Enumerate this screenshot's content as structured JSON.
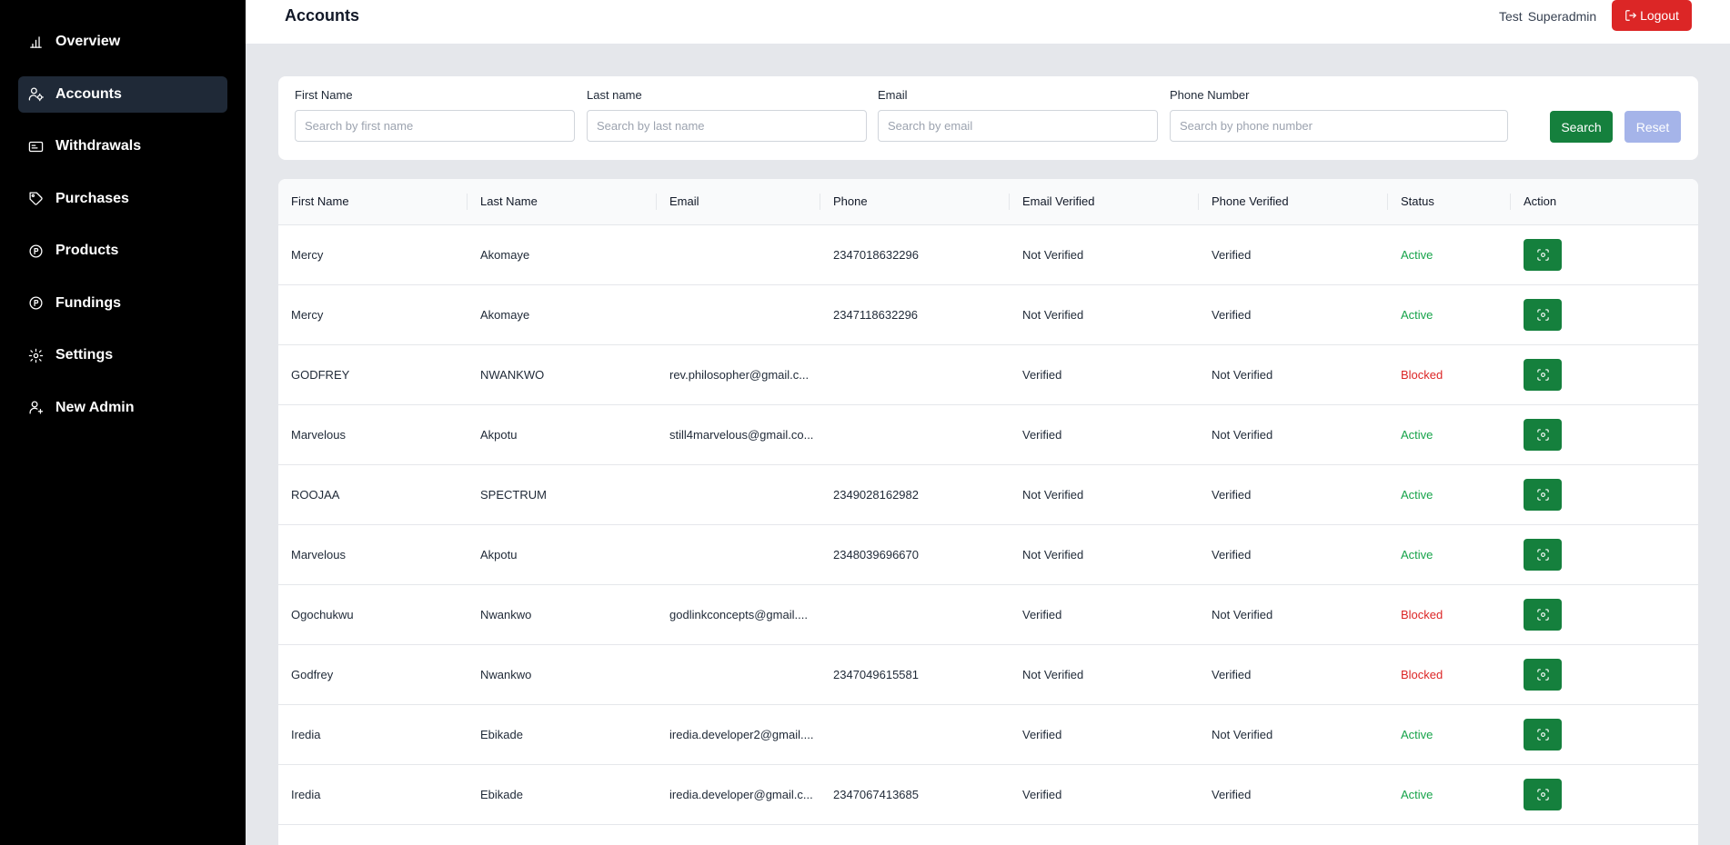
{
  "sidebar": {
    "items": [
      {
        "label": "Overview",
        "icon": "bar-chart-icon"
      },
      {
        "label": "Accounts",
        "icon": "users-gear-icon",
        "active": true
      },
      {
        "label": "Withdrawals",
        "icon": "card-icon"
      },
      {
        "label": "Purchases",
        "icon": "tag-icon"
      },
      {
        "label": "Products",
        "icon": "product-coin-icon"
      },
      {
        "label": "Fundings",
        "icon": "funding-coin-icon"
      },
      {
        "label": "Settings",
        "icon": "gear-icon"
      },
      {
        "label": "New Admin",
        "icon": "user-plus-icon"
      }
    ]
  },
  "header": {
    "title": "Accounts",
    "user_first": "Test",
    "user_last": "Superadmin",
    "logout_label": "Logout"
  },
  "filters": {
    "first_name": {
      "label": "First Name",
      "placeholder": "Search by first name",
      "value": ""
    },
    "last_name": {
      "label": "Last name",
      "placeholder": "Search by last name",
      "value": ""
    },
    "email": {
      "label": "Email",
      "placeholder": "Search by email",
      "value": ""
    },
    "phone": {
      "label": "Phone Number",
      "placeholder": "Search by phone number",
      "value": ""
    },
    "search_label": "Search",
    "reset_label": "Reset"
  },
  "table": {
    "columns": [
      "First Name",
      "Last Name",
      "Email",
      "Phone",
      "Email Verified",
      "Phone Verified",
      "Status",
      "Action"
    ],
    "rows": [
      {
        "first": "Mercy",
        "last": "Akomaye",
        "email": "",
        "phone": "2347018632296",
        "email_verified": "Not Verified",
        "phone_verified": "Verified",
        "status": "Active"
      },
      {
        "first": "Mercy",
        "last": "Akomaye",
        "email": "",
        "phone": "2347118632296",
        "email_verified": "Not Verified",
        "phone_verified": "Verified",
        "status": "Active"
      },
      {
        "first": "GODFREY",
        "last": "NWANKWO",
        "email": "rev.philosopher@gmail.c...",
        "phone": "",
        "email_verified": "Verified",
        "phone_verified": "Not Verified",
        "status": "Blocked"
      },
      {
        "first": "Marvelous",
        "last": "Akpotu",
        "email": "still4marvelous@gmail.co...",
        "phone": "",
        "email_verified": "Verified",
        "phone_verified": "Not Verified",
        "status": "Active"
      },
      {
        "first": "ROOJAA",
        "last": "SPECTRUM",
        "email": "",
        "phone": "2349028162982",
        "email_verified": "Not Verified",
        "phone_verified": "Verified",
        "status": "Active"
      },
      {
        "first": "Marvelous",
        "last": "Akpotu",
        "email": "",
        "phone": "2348039696670",
        "email_verified": "Not Verified",
        "phone_verified": "Verified",
        "status": "Active"
      },
      {
        "first": "Ogochukwu",
        "last": "Nwankwo",
        "email": "godlinkconcepts@gmail....",
        "phone": "",
        "email_verified": "Verified",
        "phone_verified": "Not Verified",
        "status": "Blocked"
      },
      {
        "first": "Godfrey",
        "last": "Nwankwo",
        "email": "",
        "phone": "2347049615581",
        "email_verified": "Not Verified",
        "phone_verified": "Verified",
        "status": "Blocked"
      },
      {
        "first": "Iredia",
        "last": "Ebikade",
        "email": "iredia.developer2@gmail....",
        "phone": "",
        "email_verified": "Verified",
        "phone_verified": "Not Verified",
        "status": "Active"
      },
      {
        "first": "Iredia",
        "last": "Ebikade",
        "email": "iredia.developer@gmail.c...",
        "phone": "2347067413685",
        "email_verified": "Verified",
        "phone_verified": "Verified",
        "status": "Active"
      }
    ],
    "action_icon": "view-scan-icon"
  },
  "colors": {
    "sidebar_bg": "#000000",
    "sidebar_active": "#1f2937",
    "primary_green": "#15803d",
    "danger_red": "#dc2626",
    "active_green": "#16a34a",
    "reset_blue": "#a5b4e9",
    "page_bg": "#e5e7eb"
  }
}
